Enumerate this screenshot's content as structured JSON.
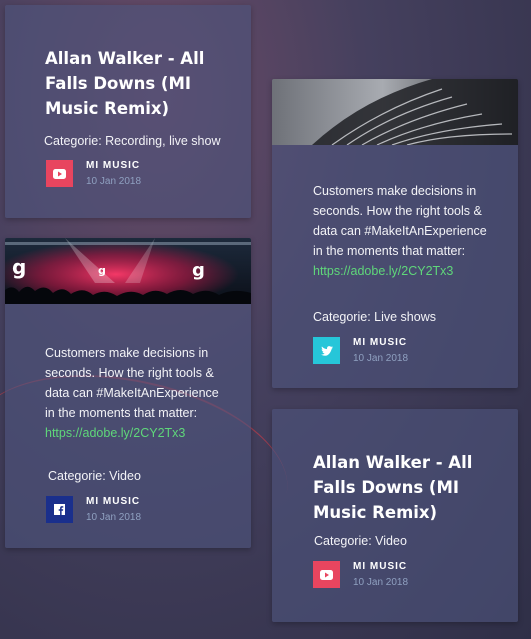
{
  "cards": [
    {
      "title": "Allan Walker - All Falls Downs (MI Music Remix)",
      "category": "Categorie: Recording, live show",
      "author": "MI MUSIC",
      "date": "10 Jan 2018",
      "badge": {
        "icon": "youtube-icon",
        "color": "#e8455f"
      }
    },
    {
      "description": "Customers make decisions in seconds. How the right tools & data can #MakeItAnExperience in the moments that matter:",
      "link": "https://adobe.ly/2CY2Tx3",
      "category": "Categorie: Video",
      "author": "MI MUSIC",
      "date": "10 Jan 2018",
      "badge": {
        "icon": "facebook-icon",
        "color": "#1a2f8c"
      }
    },
    {
      "description": "Customers make decisions in seconds. How the right tools & data can #MakeItAnExperience in the moments that matter:",
      "link": "https://adobe.ly/2CY2Tx3",
      "category": "Categorie: Live shows",
      "author": "MI MUSIC",
      "date": "10 Jan 2018",
      "badge": {
        "icon": "twitter-icon",
        "color": "#26c6d9"
      }
    },
    {
      "title": "Allan Walker - All Falls Downs (MI Music Remix)",
      "category": "Categorie: Video",
      "author": "MI MUSIC",
      "date": "10 Jan 2018",
      "badge": {
        "icon": "youtube-icon",
        "color": "#e8455f"
      }
    }
  ],
  "colors": {
    "link": "#5fd77a",
    "card_bg": "#4e547c"
  }
}
